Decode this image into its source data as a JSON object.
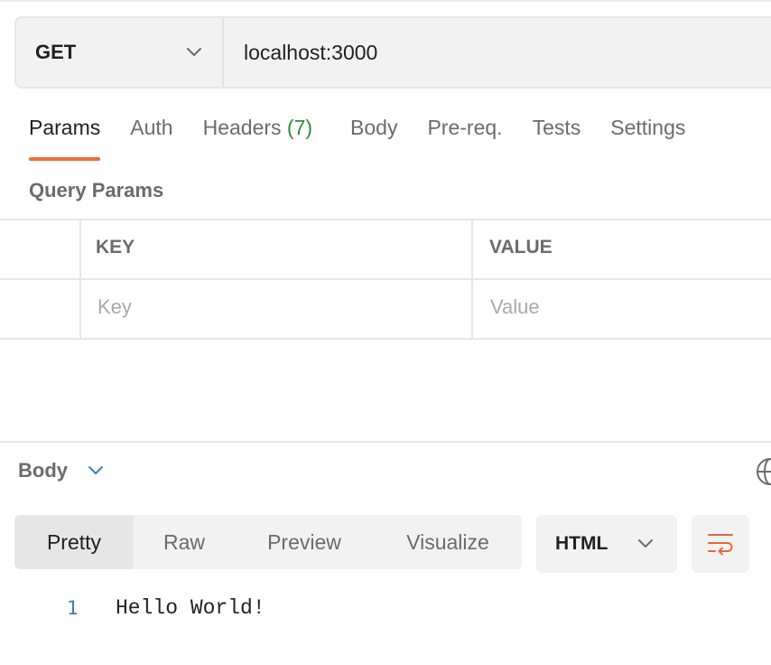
{
  "request": {
    "method": "GET",
    "url": "localhost:3000"
  },
  "tabs": [
    {
      "label": "Params",
      "active": true
    },
    {
      "label": "Auth"
    },
    {
      "label": "Headers",
      "count": "(7)"
    },
    {
      "label": "Body"
    },
    {
      "label": "Pre-req."
    },
    {
      "label": "Tests"
    },
    {
      "label": "Settings"
    }
  ],
  "query_params": {
    "title": "Query Params",
    "columns": [
      "KEY",
      "VALUE"
    ],
    "placeholders": {
      "key": "Key",
      "value": "Value"
    }
  },
  "response": {
    "section_label": "Body",
    "view_tabs": [
      "Pretty",
      "Raw",
      "Preview",
      "Visualize"
    ],
    "format": "HTML",
    "lines": [
      {
        "num": "1",
        "text": "Hello World!"
      }
    ]
  },
  "colors": {
    "accent": "#f26b3a",
    "headers_count": "#2f8d3c",
    "line_number": "#3b7fb3"
  },
  "icons": [
    "chevron-down-icon",
    "globe-icon",
    "wrap-lines-icon"
  ]
}
